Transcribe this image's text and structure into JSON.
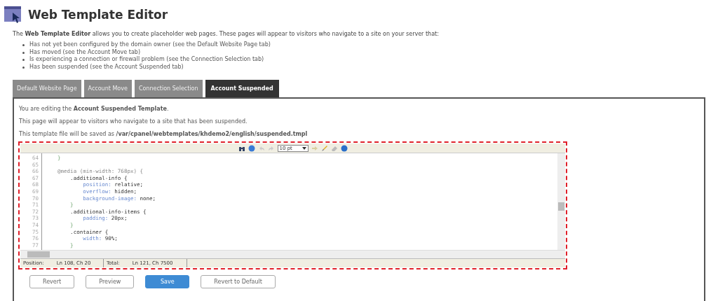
{
  "header": {
    "title": "Web Template Editor"
  },
  "intro": {
    "text": "The **Web Template Editor** allows you to create placeholder web pages. These pages will appear to visitors who navigate to a site on your server that:",
    "items": [
      "Has not yet been configured by the domain owner (see the Default Website Page tab)",
      "Has moved (see the Account Move tab)",
      "Is experiencing a connection or firewall problem (see the Connection Selection tab)",
      "Has been suspended (see the Account Suspended tab)"
    ]
  },
  "tabs": [
    {
      "label": "Default Website Page",
      "selected": false
    },
    {
      "label": "Account Move",
      "selected": false
    },
    {
      "label": "Connection Selection",
      "selected": false
    },
    {
      "label": "Account Suspended",
      "selected": true
    }
  ],
  "panel": {
    "lines": [
      "You are editing the **Account Suspended Template**.",
      "This page will appear to visitors who navigate to a site that has been suspended.",
      "This template file will be saved as **/var/cpanel/webtemplates/khdemo2/english/suspended.tmpl**"
    ]
  },
  "editor": {
    "highlighted": true,
    "toolbar": {
      "font_size": "10 pt"
    },
    "code": [
      {
        "number": "64",
        "kind": "brace",
        "text": "    }"
      },
      {
        "number": "65",
        "kind": "blank"
      },
      {
        "number": "66",
        "kind": "atrule",
        "text": "    @media (min-width: 768px) {"
      },
      {
        "number": "67",
        "kind": "selector",
        "text": "        .additional-info {"
      },
      {
        "number": "68",
        "kind": "declaration",
        "text": "            position:",
        "value": " relative;"
      },
      {
        "number": "69",
        "kind": "declaration",
        "text": "            overflow:",
        "value": " hidden;"
      },
      {
        "number": "70",
        "kind": "declaration",
        "text": "            background-image:",
        "value": " none;"
      },
      {
        "number": "71",
        "kind": "brace",
        "text": "        }"
      },
      {
        "number": "72",
        "kind": "selector",
        "text": "        .additional-info-items {"
      },
      {
        "number": "73",
        "kind": "declaration",
        "text": "            padding:",
        "value": " 20px;"
      },
      {
        "number": "74",
        "kind": "brace",
        "text": "        }"
      },
      {
        "number": "75",
        "kind": "selector",
        "text": "        .container {"
      },
      {
        "number": "76",
        "kind": "declaration",
        "text": "            width:",
        "value": " 90%;"
      },
      {
        "number": "77",
        "kind": "brace",
        "text": "        }"
      }
    ],
    "status": [
      {
        "label": "Position:",
        "value": "Ln 108, Ch 20"
      },
      {
        "label": "Total:",
        "value": "Ln 121, Ch 7500"
      }
    ]
  },
  "buttons": [
    {
      "label": "Revert",
      "kind": "secondary"
    },
    {
      "label": "Preview",
      "kind": "secondary"
    },
    {
      "label": "Save",
      "kind": "primary"
    },
    {
      "label": "Revert to Default",
      "kind": "secondary"
    }
  ]
}
